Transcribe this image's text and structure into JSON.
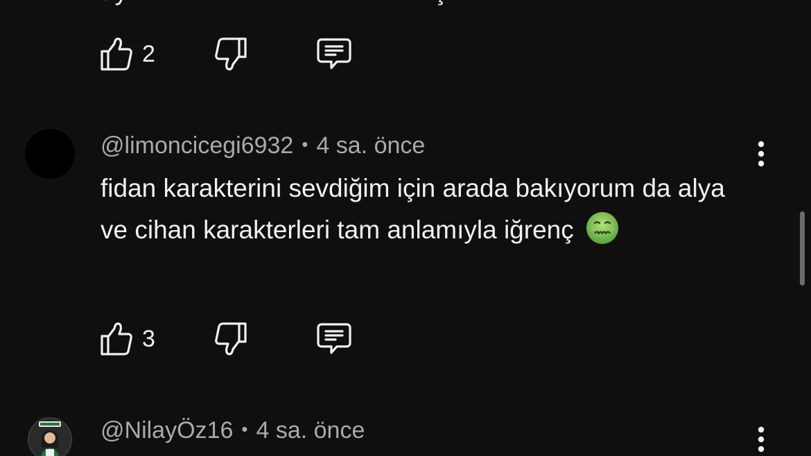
{
  "colors": {
    "background": "#0f0f0f",
    "text_primary": "#f1f1f1",
    "text_secondary": "#aaaaaa",
    "scrollbar": "#6b6b6b"
  },
  "top_actions": {
    "like_count": "2",
    "like_icon": "thumbs-up-icon",
    "dislike_icon": "thumbs-down-icon",
    "reply_icon": "reply-icon"
  },
  "comments": [
    {
      "handle": "@limoncicegi6932",
      "separator": "•",
      "time": "4 sa. önce",
      "text": "fidan karakterini sevdiğim için arada bakıyorum da alya ve cihan karakterleri tam anlamıyla iğrenç",
      "emoji": "nauseated-face-emoji",
      "like_count": "3",
      "menu_icon": "more-vertical-icon"
    },
    {
      "handle": "@NilayÖz16",
      "separator": "•",
      "time": "4 sa. önce",
      "menu_icon": "more-vertical-icon"
    }
  ]
}
